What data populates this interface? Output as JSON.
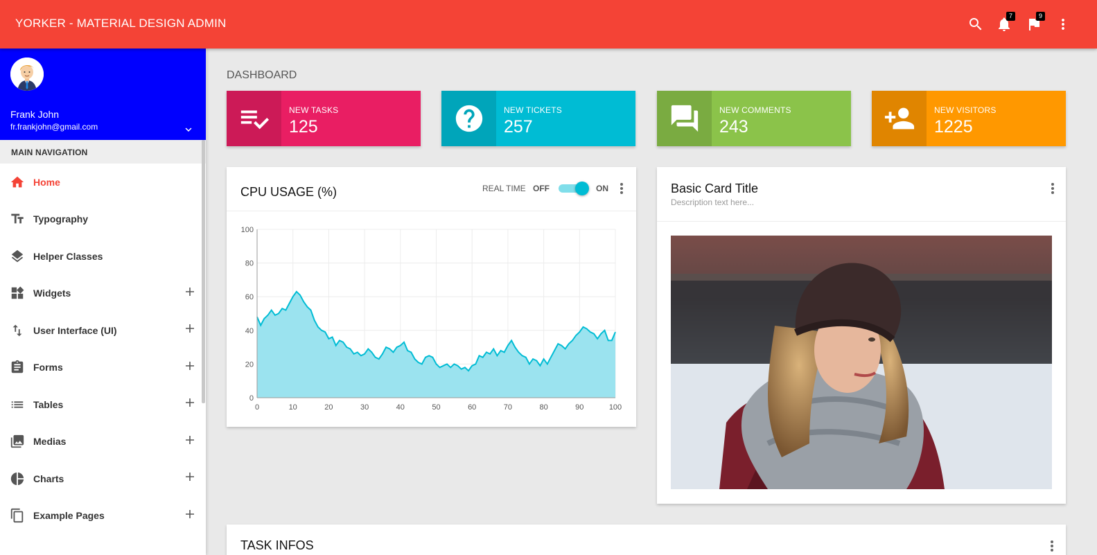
{
  "app": {
    "title": "YORKER - MATERIAL DESIGN ADMIN"
  },
  "topbar": {
    "icons": [
      "search-icon",
      "notifications-icon",
      "flag-icon",
      "more-vert-icon"
    ],
    "notifications_count": "7",
    "flags_count": "9"
  },
  "user": {
    "name": "Frank John",
    "email": "fr.frankjohn@gmail.com"
  },
  "sidebar": {
    "header": "MAIN NAVIGATION",
    "items": [
      {
        "label": "Home",
        "icon": "home-icon",
        "active": true,
        "expandable": false
      },
      {
        "label": "Typography",
        "icon": "text-fields-icon",
        "active": false,
        "expandable": false
      },
      {
        "label": "Helper Classes",
        "icon": "layers-icon",
        "active": false,
        "expandable": false
      },
      {
        "label": "Widgets",
        "icon": "widgets-icon",
        "active": false,
        "expandable": true
      },
      {
        "label": "User Interface (UI)",
        "icon": "swap-vert-icon",
        "active": false,
        "expandable": true
      },
      {
        "label": "Forms",
        "icon": "assignment-icon",
        "active": false,
        "expandable": true
      },
      {
        "label": "Tables",
        "icon": "list-icon",
        "active": false,
        "expandable": true
      },
      {
        "label": "Medias",
        "icon": "photo-library-icon",
        "active": false,
        "expandable": true
      },
      {
        "label": "Charts",
        "icon": "pie-chart-icon",
        "active": false,
        "expandable": true
      },
      {
        "label": "Example Pages",
        "icon": "content-copy-icon",
        "active": false,
        "expandable": true
      }
    ]
  },
  "page": {
    "title": "DASHBOARD"
  },
  "infoboxes": [
    {
      "label": "NEW TASKS",
      "value": "125",
      "color": "#e91e63",
      "icon": "playlist-check-icon"
    },
    {
      "label": "NEW TICKETS",
      "value": "257",
      "color": "#00bcd4",
      "icon": "help-icon"
    },
    {
      "label": "NEW COMMENTS",
      "value": "243",
      "color": "#8bc34a",
      "icon": "forum-icon"
    },
    {
      "label": "NEW VISITORS",
      "value": "1225",
      "color": "#ff9800",
      "icon": "person-add-icon"
    }
  ],
  "cpu_card": {
    "title": "CPU USAGE (%)",
    "realtime_label": "REAL TIME",
    "off_label": "OFF",
    "on_label": "ON",
    "realtime_on": true
  },
  "chart_data": {
    "type": "area",
    "title": "",
    "xlabel": "",
    "ylabel": "",
    "xlim": [
      0,
      100
    ],
    "ylim": [
      0,
      100
    ],
    "xticks": [
      0,
      10,
      20,
      30,
      40,
      50,
      60,
      70,
      80,
      90,
      100
    ],
    "yticks": [
      0,
      20,
      40,
      60,
      80,
      100
    ],
    "grid": true,
    "color": "#00bcd4",
    "fill": "#9be3ef",
    "series": [
      {
        "x": [
          0,
          1,
          2,
          3,
          4,
          5,
          6,
          7,
          8,
          9,
          10,
          11,
          12,
          13,
          14,
          15,
          16,
          17,
          18,
          19,
          20,
          21,
          22,
          23,
          24,
          25,
          26,
          27,
          28,
          29,
          30,
          31,
          32,
          33,
          34,
          35,
          36,
          37,
          38,
          39,
          40,
          41,
          42,
          43,
          44,
          45,
          46,
          47,
          48,
          49,
          50,
          51,
          52,
          53,
          54,
          55,
          56,
          57,
          58,
          59,
          60,
          61,
          62,
          63,
          64,
          65,
          66,
          67,
          68,
          69,
          70,
          71,
          72,
          73,
          74,
          75,
          76,
          77,
          78,
          79,
          80,
          81,
          82,
          83,
          84,
          85,
          86,
          87,
          88,
          89,
          90,
          91,
          92,
          93,
          94,
          95,
          96,
          97,
          98,
          99,
          100
        ],
        "values": [
          48,
          43,
          47,
          49,
          52,
          49,
          50,
          53,
          52,
          56,
          60,
          63,
          61,
          57,
          54,
          52,
          46,
          42,
          40,
          39,
          35,
          36,
          31,
          34,
          33,
          30,
          29,
          26,
          27,
          25,
          26,
          29,
          27,
          24,
          23,
          26,
          30,
          29,
          27,
          30,
          31,
          33,
          28,
          27,
          23,
          21,
          20,
          24,
          25,
          24,
          20,
          18,
          19,
          20,
          18,
          20,
          19,
          17,
          18,
          16,
          19,
          20,
          25,
          24,
          27,
          26,
          29,
          25,
          28,
          27,
          31,
          34,
          30,
          27,
          25,
          24,
          20,
          23,
          22,
          19,
          23,
          20,
          24,
          28,
          32,
          31,
          29,
          32,
          34,
          37,
          39,
          42,
          41,
          39,
          38,
          35,
          38,
          40,
          34,
          34,
          39
        ]
      }
    ]
  },
  "basic_card": {
    "title": "Basic Card Title",
    "description": "Description text here..."
  },
  "task_card": {
    "title": "TASK INFOS"
  }
}
